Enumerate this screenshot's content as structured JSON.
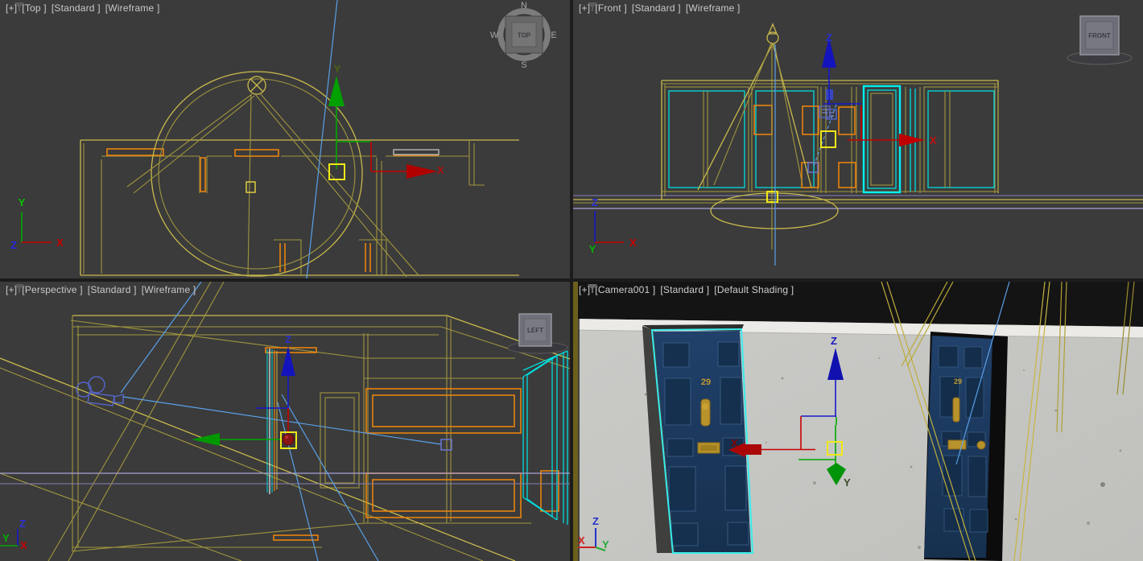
{
  "viewports": {
    "top": {
      "menu": "[+]",
      "view": "[Top ]",
      "renderer": "[Standard ]",
      "shading": "[Wireframe ]"
    },
    "front": {
      "menu": "[+]",
      "view": "[Front ]",
      "renderer": "[Standard ]",
      "shading": "[Wireframe ]"
    },
    "perspective": {
      "menu": "[+]",
      "view": "[Perspective ]",
      "renderer": "[Standard ]",
      "shading": "[Wireframe ]"
    },
    "camera": {
      "menu": "[+]",
      "view": "[Camera001 ]",
      "renderer": "[Standard ]",
      "shading": "[Default Shading ]"
    }
  },
  "viewcube": {
    "top": "TOP",
    "front": "FRONT",
    "left": "LEFT",
    "compass_n": "N",
    "compass_e": "E",
    "compass_s": "S",
    "compass_w": "W"
  },
  "axes": {
    "x": "X",
    "y": "Y",
    "z": "Z"
  },
  "scene": {
    "door_number": "29"
  },
  "colors": {
    "viewport_bg": "#3b3b3b",
    "wire_yellow": "#c9ba4c",
    "wire_olive": "#a0953e",
    "wire_orange": "#e8820e",
    "wire_cyan": "#00dede",
    "selection_yellow": "#f0e818",
    "gizmo_red": "#c80000",
    "gizmo_green": "#00a800",
    "gizmo_blue": "#1818c8",
    "camera_line_blue": "#5aa0e8",
    "lavender": "#a89fd8",
    "door_blue": "#1d3c62",
    "gold": "#b8922a",
    "concrete": "#c7c8c4"
  }
}
